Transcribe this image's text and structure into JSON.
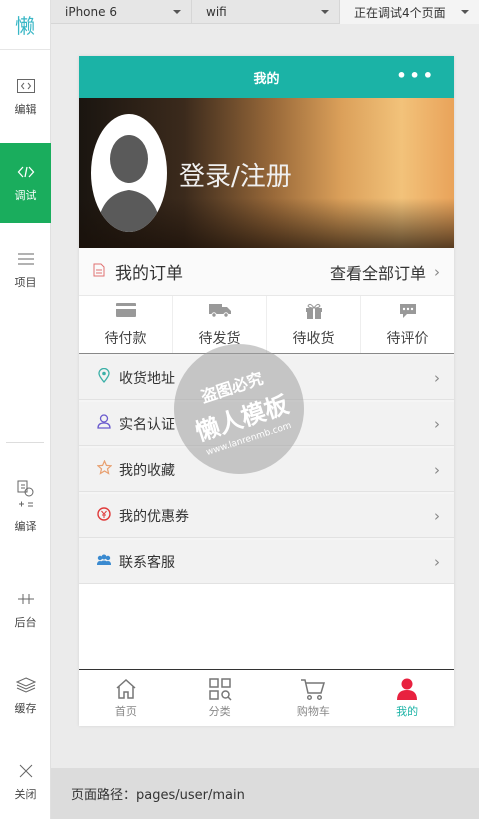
{
  "ide": {
    "logo": "懒",
    "items": [
      {
        "label": "编辑",
        "icon": "code-icon"
      },
      {
        "label": "调试",
        "icon": "debug-icon"
      },
      {
        "label": "项目",
        "icon": "menu-icon"
      },
      {
        "label": "编译",
        "icon": "compile-icon"
      },
      {
        "label": "后台",
        "icon": "background-icon"
      },
      {
        "label": "缓存",
        "icon": "layers-icon"
      },
      {
        "label": "关闭",
        "icon": "close-icon"
      }
    ],
    "active_index": 1
  },
  "toolbar": {
    "device": "iPhone 6",
    "network": "wifi",
    "pages": "正在调试4个页面"
  },
  "phone": {
    "nav_title": "我的",
    "nav_more": "•••",
    "login_text": "登录/注册",
    "orders": {
      "title": "我的订单",
      "view_all": "查看全部订单",
      "tabs": [
        {
          "label": "待付款",
          "icon": "card-icon"
        },
        {
          "label": "待发货",
          "icon": "truck-icon"
        },
        {
          "label": "待收货",
          "icon": "gift-icon"
        },
        {
          "label": "待评价",
          "icon": "comment-icon"
        }
      ]
    },
    "menu": [
      {
        "label": "收货地址",
        "icon": "location-icon",
        "color": "#3bb0a7"
      },
      {
        "label": "实名认证",
        "icon": "user-icon",
        "color": "#6a5acd"
      },
      {
        "label": "我的收藏",
        "icon": "star-icon",
        "color": "#e8a070"
      },
      {
        "label": "我的优惠券",
        "icon": "coupon-icon",
        "color": "#e03a3a"
      },
      {
        "label": "联系客服",
        "icon": "service-icon",
        "color": "#3a8ad0"
      }
    ],
    "tabbar": [
      {
        "label": "首页",
        "icon": "home-icon"
      },
      {
        "label": "分类",
        "icon": "category-icon"
      },
      {
        "label": "购物车",
        "icon": "cart-icon"
      },
      {
        "label": "我的",
        "icon": "profile-icon"
      }
    ],
    "tabbar_active": 3
  },
  "watermark": {
    "line1": "盗图必究",
    "line2": "懒人模板",
    "line3": "www.lanrenmb.com"
  },
  "path_label": "页面路径：pages/user/main",
  "colors": {
    "primary": "#1bb3a6",
    "ide_active": "#1aad5d",
    "tab_active_icon": "#e8213f"
  }
}
